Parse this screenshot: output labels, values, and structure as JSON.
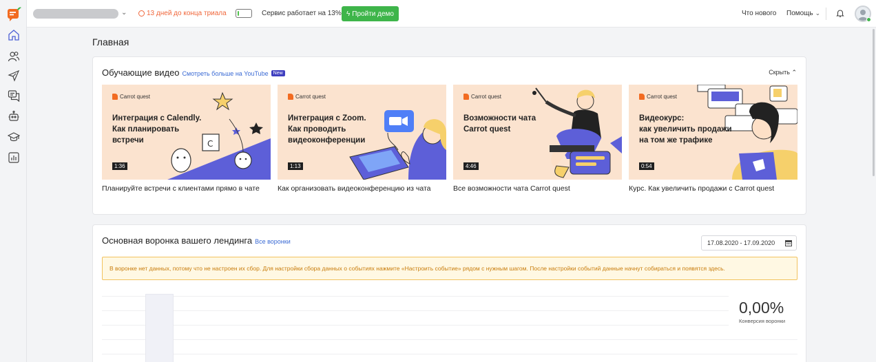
{
  "topbar": {
    "trial_text": "13 дней до конца триала",
    "service_text": "Сервис работает на 13%",
    "service_level_percent": 13,
    "demo_button": "Пройти демо",
    "whats_new": "Что нового",
    "help": "Помощь"
  },
  "page": {
    "title": "Главная"
  },
  "videos_card": {
    "title": "Обучающие видео",
    "more_link": "Смотреть больше на YouTube",
    "new_badge": "New",
    "hide": "Скрыть",
    "brand": "Carrot quest",
    "videos": [
      {
        "thumb_title": "Интеграция с Calendly.\nКак планировать\nвстречи",
        "duration": "1:36",
        "caption": "Планируйте встречи с клиентами прямо в чате"
      },
      {
        "thumb_title": "Интеграция с Zoom.\nКак проводить\nвидеоконференции",
        "duration": "1:13",
        "caption": "Как организовать видеоконференцию из чата"
      },
      {
        "thumb_title": "Возможности чата\nCarrot quest",
        "duration": "4:46",
        "caption": "Все возможности чата Carrot quest"
      },
      {
        "thumb_title": "Видеокурс:\nкак увеличить продажи\nна том же трафике",
        "duration": "0:54",
        "caption": "Курс. Как увеличить продажи с Carrot quest"
      }
    ]
  },
  "funnel_card": {
    "title": "Основная воронка вашего лендинга",
    "all_funnels_link": "Все воронки",
    "date_range": "17.08.2020 - 17.09.2020",
    "warning": "В воронке нет данных, потому что не настроен их сбор. Для настройки сбора данных о событиях нажмите «Настроить событие» рядом с нужным шагом. После настройки событий данные начнут собираться и появятся здесь.",
    "conversion_value": "0,00%",
    "conversion_label": "Конверсия воронки"
  },
  "colors": {
    "accent_green": "#3eb54a",
    "trial_orange": "#f0663a",
    "link_blue": "#3a6ad4",
    "brand_orange": "#f26b21",
    "warning_bg": "#fff8e3"
  }
}
